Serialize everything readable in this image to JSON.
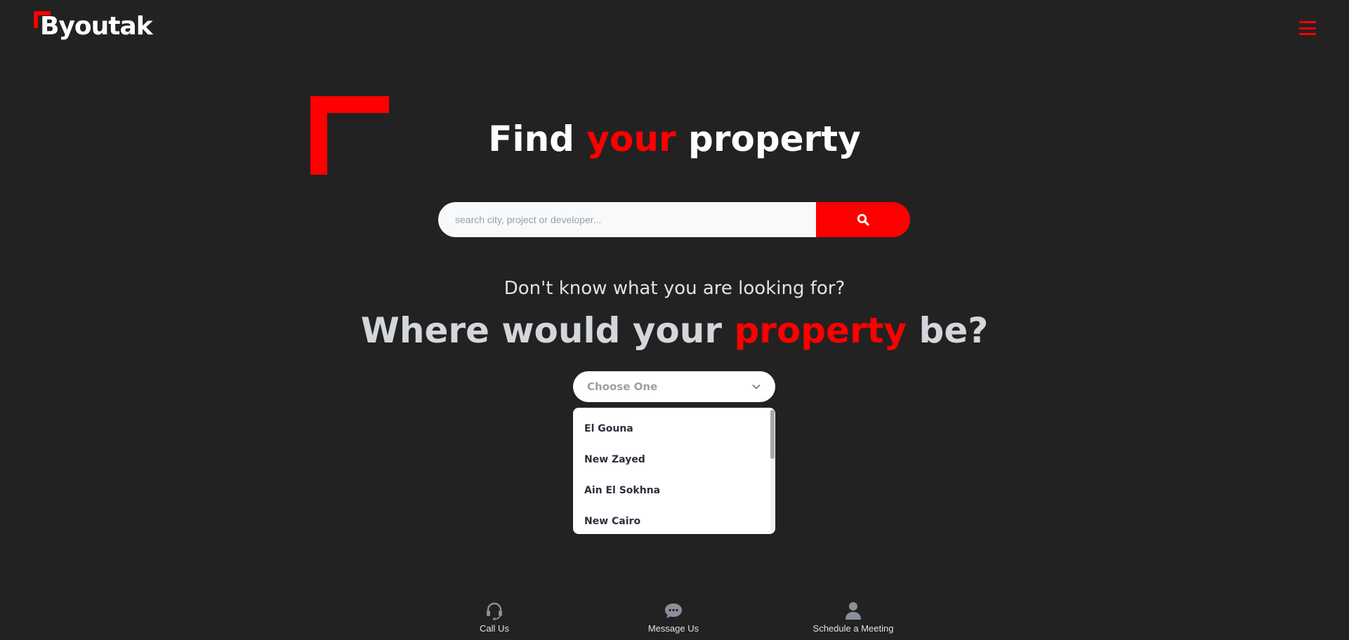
{
  "brand": {
    "name": "Byoutak",
    "accent_color": "#ff0000",
    "background_color": "#222222"
  },
  "header": {
    "menu_icon": "hamburger-menu-icon"
  },
  "hero": {
    "title_part1": "Find",
    "title_accent": "your",
    "title_part2": "property"
  },
  "search": {
    "placeholder": "search city, project or developer...",
    "value": "",
    "button_icon": "search-icon"
  },
  "location_prompt": {
    "question": "Don't know what you are looking for?",
    "title_part1": "Where would your",
    "title_accent": "property",
    "title_part2": "be?"
  },
  "location_select": {
    "selected_label": "Choose One",
    "options": [
      "El Gouna",
      "New Zayed",
      "Ain El Sokhna",
      "New Cairo"
    ]
  },
  "footer": {
    "actions": [
      {
        "label": "Call Us",
        "icon": "headset-icon"
      },
      {
        "label": "Message Us",
        "icon": "chat-bubble-icon"
      },
      {
        "label": "Schedule a Meeting",
        "icon": "user-icon"
      }
    ]
  }
}
